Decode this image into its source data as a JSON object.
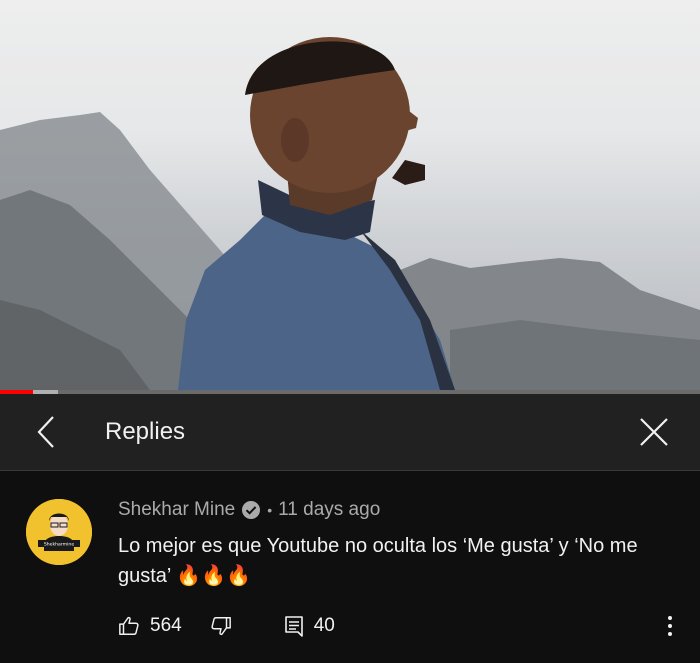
{
  "replies_panel": {
    "title": "Replies"
  },
  "comment": {
    "author": "Shekhar Mine",
    "separator": "•",
    "time": "11 days ago",
    "text": "Lo mejor es que Youtube no oculta los ‘Me gusta’ y ‘No me gusta’ 🔥🔥🔥",
    "avatar_caption": "Shekharmine",
    "like_count": "564",
    "reply_count": "40"
  },
  "player": {
    "progress_played_fraction": 0.047,
    "progress_buffered_fraction": 0.083
  },
  "icons": {
    "back": "chevron-left-icon",
    "close": "close-icon",
    "verified": "verified-check-icon",
    "like": "thumbs-up-icon",
    "dislike": "thumbs-down-icon",
    "reply": "reply-comment-icon",
    "more": "more-vertical-icon"
  },
  "colors": {
    "background": "#0f0f0f",
    "header": "#212121",
    "progress_played": "#ff0000",
    "avatar_bg": "#f2c12e",
    "text_primary": "#f1f1f1",
    "text_secondary": "#aaaaaa"
  }
}
